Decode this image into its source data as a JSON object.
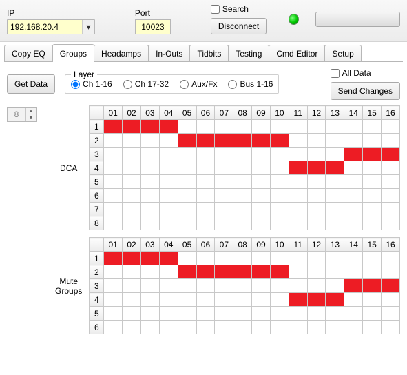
{
  "top": {
    "ip_label": "IP",
    "ip_value": "192.168.20.4",
    "port_label": "Port",
    "port_value": "10023",
    "search_label": "Search",
    "search_checked": false,
    "disconnect_label": "Disconnect"
  },
  "tabs": [
    "Copy EQ",
    "Groups",
    "Headamps",
    "In-Outs",
    "Tidbits",
    "Testing",
    "Cmd Editor",
    "Setup"
  ],
  "active_tab": 1,
  "groups": {
    "get_data_label": "Get Data",
    "layer_legend": "Layer",
    "layer_options": [
      "Ch 1-16",
      "Ch 17-32",
      "Aux/Fx",
      "Bus 1-16"
    ],
    "layer_selected": 0,
    "all_data_label": "All Data",
    "all_data_checked": false,
    "send_changes_label": "Send Changes",
    "spinner_value": "8",
    "columns": [
      "01",
      "02",
      "03",
      "04",
      "05",
      "06",
      "07",
      "08",
      "09",
      "10",
      "11",
      "12",
      "13",
      "14",
      "15",
      "16"
    ],
    "dca": {
      "label": "DCA",
      "rows": [
        "1",
        "2",
        "3",
        "4",
        "5",
        "6",
        "7",
        "8"
      ],
      "cells": [
        [
          1,
          1,
          1,
          1,
          0,
          0,
          0,
          0,
          0,
          0,
          0,
          0,
          0,
          0,
          0,
          0
        ],
        [
          0,
          0,
          0,
          0,
          1,
          1,
          1,
          1,
          1,
          1,
          0,
          0,
          0,
          0,
          0,
          0
        ],
        [
          0,
          0,
          0,
          0,
          0,
          0,
          0,
          0,
          0,
          0,
          0,
          0,
          0,
          1,
          1,
          1
        ],
        [
          0,
          0,
          0,
          0,
          0,
          0,
          0,
          0,
          0,
          0,
          1,
          1,
          1,
          0,
          0,
          0
        ],
        [
          0,
          0,
          0,
          0,
          0,
          0,
          0,
          0,
          0,
          0,
          0,
          0,
          0,
          0,
          0,
          0
        ],
        [
          0,
          0,
          0,
          0,
          0,
          0,
          0,
          0,
          0,
          0,
          0,
          0,
          0,
          0,
          0,
          0
        ],
        [
          0,
          0,
          0,
          0,
          0,
          0,
          0,
          0,
          0,
          0,
          0,
          0,
          0,
          0,
          0,
          0
        ],
        [
          0,
          0,
          0,
          0,
          0,
          0,
          0,
          0,
          0,
          0,
          0,
          0,
          0,
          0,
          0,
          0
        ]
      ]
    },
    "mute": {
      "label": "Mute Groups",
      "rows": [
        "1",
        "2",
        "3",
        "4",
        "5",
        "6"
      ],
      "cells": [
        [
          1,
          1,
          1,
          1,
          0,
          0,
          0,
          0,
          0,
          0,
          0,
          0,
          0,
          0,
          0,
          0
        ],
        [
          0,
          0,
          0,
          0,
          1,
          1,
          1,
          1,
          1,
          1,
          0,
          0,
          0,
          0,
          0,
          0
        ],
        [
          0,
          0,
          0,
          0,
          0,
          0,
          0,
          0,
          0,
          0,
          0,
          0,
          0,
          1,
          1,
          1
        ],
        [
          0,
          0,
          0,
          0,
          0,
          0,
          0,
          0,
          0,
          0,
          1,
          1,
          1,
          0,
          0,
          0
        ],
        [
          0,
          0,
          0,
          0,
          0,
          0,
          0,
          0,
          0,
          0,
          0,
          0,
          0,
          0,
          0,
          0
        ],
        [
          0,
          0,
          0,
          0,
          0,
          0,
          0,
          0,
          0,
          0,
          0,
          0,
          0,
          0,
          0,
          0
        ]
      ]
    }
  }
}
